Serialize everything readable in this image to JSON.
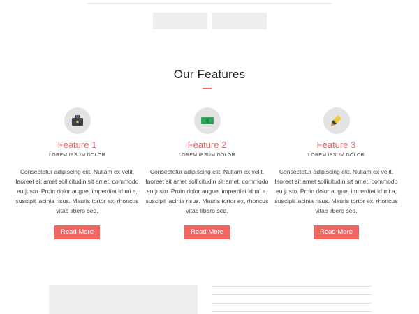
{
  "section": {
    "title": "Our Features"
  },
  "features": [
    {
      "title": "Feature 1",
      "subtitle": "LOREM IPSUM DOLOR",
      "text": "Consectetur adipiscing elit. Nullam ex velit, laoreet sit amet sollicitudin sit amet, commodo eu justo. Proin dolor augue, imperdiet id mi a, suscipit lacinia risus. Mauris tortor ex, rhoncus vitae libero sed.",
      "button": "Read More",
      "icon": "briefcase-icon"
    },
    {
      "title": "Feature 2",
      "subtitle": "LOREM IPSUM DOLOR",
      "text": "Consectetur adipiscing elit. Nullam ex velit, laoreet sit amet sollicitudin sit amet, commodo eu justo. Proin dolor augue, imperdiet id mi a, suscipit lacinia risus. Mauris tortor ex, rhoncus vitae libero sed.",
      "button": "Read More",
      "icon": "money-icon"
    },
    {
      "title": "Feature 3",
      "subtitle": "LOREM IPSUM DOLOR",
      "text": "Consectetur adipiscing elit. Nullam ex velit, laoreet sit amet sollicitudin sit amet, commodo eu justo. Proin dolor augue, imperdiet id mi a, suscipit lacinia risus. Mauris tortor ex, rhoncus vitae libero sed.",
      "button": "Read More",
      "icon": "highlighter-icon"
    }
  ],
  "colors": {
    "accent": "#f26661",
    "placeholder": "#eeeeee",
    "icon_bg": "#e3e3e3"
  }
}
